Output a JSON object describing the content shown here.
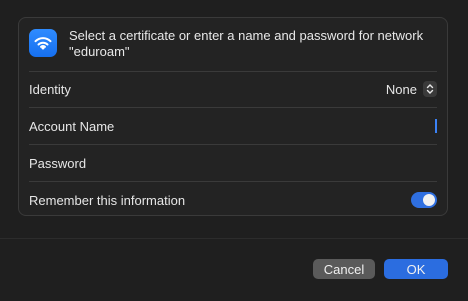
{
  "dialog": {
    "prompt": "Select a certificate or enter a name and password for network \"eduroam\"",
    "icon": "wifi-icon"
  },
  "identity": {
    "label": "Identity",
    "value": "None"
  },
  "account_name": {
    "label": "Account Name",
    "value": ""
  },
  "password": {
    "label": "Password",
    "value": ""
  },
  "remember": {
    "label": "Remember this information",
    "enabled": true
  },
  "buttons": {
    "cancel": "Cancel",
    "ok": "OK"
  },
  "colors": {
    "accent": "#2b6de0",
    "cancel_bg": "#5a5a5a",
    "background": "#1f1f1f"
  }
}
